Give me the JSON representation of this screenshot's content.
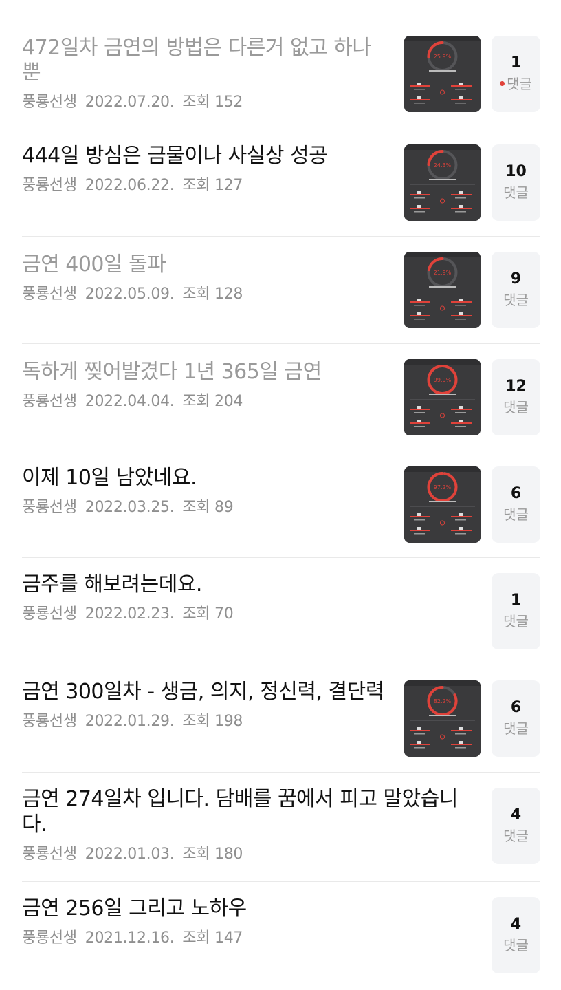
{
  "posts": [
    {
      "title": "472일차 금연의 방법은 다른거 없고 하나 뿐",
      "author": "풍룡선생",
      "date": "2022.07.20.",
      "views": "조회 152",
      "comments": "1",
      "comment_label": "댓글",
      "thumb_percent": "25.9",
      "has_thumb": true,
      "read": true,
      "new_comment": true
    },
    {
      "title": "444일 방심은 금물이나 사실상 성공",
      "author": "풍룡선생",
      "date": "2022.06.22.",
      "views": "조회 127",
      "comments": "10",
      "comment_label": "댓글",
      "thumb_percent": "24.3",
      "has_thumb": true,
      "read": false,
      "new_comment": false
    },
    {
      "title": "금연 400일 돌파",
      "author": "풍룡선생",
      "date": "2022.05.09.",
      "views": "조회 128",
      "comments": "9",
      "comment_label": "댓글",
      "thumb_percent": "21.9",
      "has_thumb": true,
      "read": true,
      "new_comment": false
    },
    {
      "title": "독하게 찢어발겼다 1년 365일 금연",
      "author": "풍룡선생",
      "date": "2022.04.04.",
      "views": "조회 204",
      "comments": "12",
      "comment_label": "댓글",
      "thumb_percent": "99.9",
      "has_thumb": true,
      "read": true,
      "new_comment": false
    },
    {
      "title": "이제 10일 남았네요.",
      "author": "풍룡선생",
      "date": "2022.03.25.",
      "views": "조회 89",
      "comments": "6",
      "comment_label": "댓글",
      "thumb_percent": "97.2",
      "has_thumb": true,
      "read": false,
      "new_comment": false
    },
    {
      "title": "금주를 해보려는데요.",
      "author": "풍룡선생",
      "date": "2022.02.23.",
      "views": "조회 70",
      "comments": "1",
      "comment_label": "댓글",
      "has_thumb": false,
      "read": false,
      "new_comment": false
    },
    {
      "title": "금연 300일차 - 생금, 의지, 정신력, 결단력",
      "author": "풍룡선생",
      "date": "2022.01.29.",
      "views": "조회 198",
      "comments": "6",
      "comment_label": "댓글",
      "thumb_percent": "82.2",
      "has_thumb": true,
      "read": false,
      "new_comment": false
    },
    {
      "title": "금연 274일차 입니다. 담배를 꿈에서 피고 말았습니다.",
      "author": "풍룡선생",
      "date": "2022.01.03.",
      "views": "조회 180",
      "comments": "4",
      "comment_label": "댓글",
      "has_thumb": false,
      "read": false,
      "new_comment": false
    },
    {
      "title": "금연 256일 그리고 노하우",
      "author": "풍룡선생",
      "date": "2021.12.16.",
      "views": "조회 147",
      "comments": "4",
      "comment_label": "댓글",
      "has_thumb": false,
      "read": false,
      "new_comment": false
    }
  ],
  "colors": {
    "accent_red": "#e0423a",
    "thumb_bg": "#3a3a3c"
  }
}
